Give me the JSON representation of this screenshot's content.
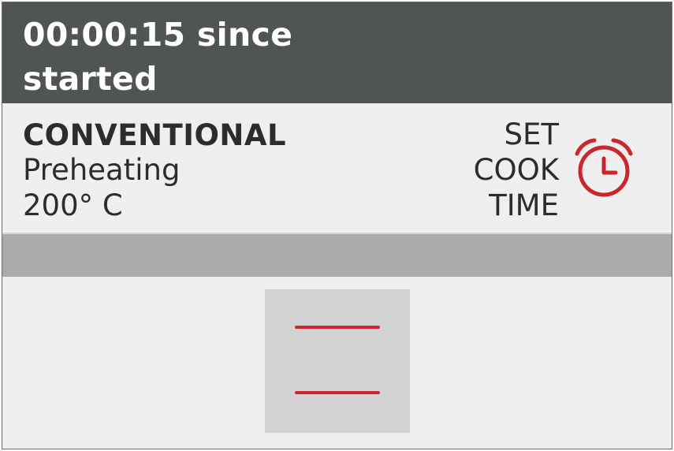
{
  "header": {
    "elapsed_text": "00:00:15 since started"
  },
  "status": {
    "mode": "CONVENTIONAL",
    "phase": "Preheating",
    "temperature": "200° C"
  },
  "cook_time": {
    "label_lines": [
      "SET",
      "COOK",
      "TIME"
    ],
    "icon": "alarm-clock-icon",
    "icon_color": "#c9262d"
  },
  "progress": {
    "value": 0
  },
  "oven_visual": {
    "heating_elements": [
      "top-heating-element-icon",
      "bottom-heating-element-icon"
    ],
    "element_color": "#c9262d"
  },
  "colors": {
    "header_background": "#505454",
    "status_background": "#efefef",
    "progress_background": "#a9acab",
    "accent": "#c9262d"
  }
}
